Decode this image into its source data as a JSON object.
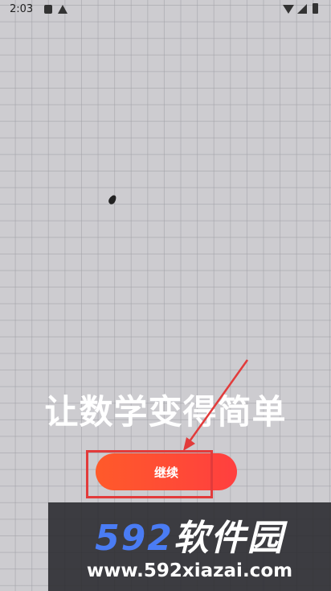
{
  "status_bar": {
    "time": "2:03",
    "icons": [
      "notification-a-icon",
      "warning-icon",
      "wifi-icon",
      "signal-icon",
      "battery-icon"
    ]
  },
  "main": {
    "slogan": "让数学变得简单",
    "continue_label": "继续"
  },
  "annotation": {
    "highlight_color": "#e23b3b"
  },
  "watermark": {
    "logo_digits": "592",
    "logo_text": "软件园",
    "url": "www.592xiazai.com"
  },
  "colors": {
    "background": "#cdccd0",
    "button_gradient_start": "#ff5a2a",
    "button_gradient_end": "#ff3f3f",
    "logo_blue": "#4a7cf4"
  }
}
